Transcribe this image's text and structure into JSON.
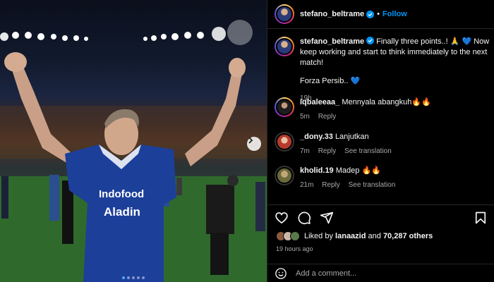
{
  "post": {
    "username": "stefano_beltrame",
    "follow_label": "Follow",
    "separator": "•",
    "carousel": {
      "dot_count": 5,
      "active_dot": 0,
      "next_icon": "chevron-right-icon"
    },
    "photo": {
      "jersey_text_1": "Indofood",
      "jersey_text_2": "Aladin"
    }
  },
  "caption": {
    "username": "stefano_beltrame",
    "line1": "Finally three points..! 🙏 💙 Now keep working and start to think immediately to the next match!",
    "line2": "Forza Persib.. 💙",
    "time": "19h"
  },
  "comments": [
    {
      "username": "iqbaleeaa_",
      "text": "Mennyala abangkuh🔥🔥",
      "time": "5m",
      "reply": "Reply",
      "translate": ""
    },
    {
      "username": "_dony.33",
      "text": "Lanjutkan",
      "time": "7m",
      "reply": "Reply",
      "translate": "See translation"
    },
    {
      "username": "kholid.19",
      "text": "Madep 🔥🔥",
      "time": "21m",
      "reply": "Reply",
      "translate": "See translation"
    }
  ],
  "actions": {
    "like_icon": "heart-icon",
    "comment_icon": "comment-icon",
    "share_icon": "share-icon",
    "save_icon": "bookmark-icon"
  },
  "likes": {
    "prefix": "Liked by",
    "user": "lanaazid",
    "connector": "and",
    "others": "70,287 others"
  },
  "timeago": "19 hours ago",
  "add_comment": {
    "placeholder": "Add a comment...",
    "emoji_icon": "emoji-icon"
  },
  "colors": {
    "accent": "#0095f6",
    "muted": "#a8a8a8",
    "background": "#000000",
    "divider": "#262626"
  }
}
